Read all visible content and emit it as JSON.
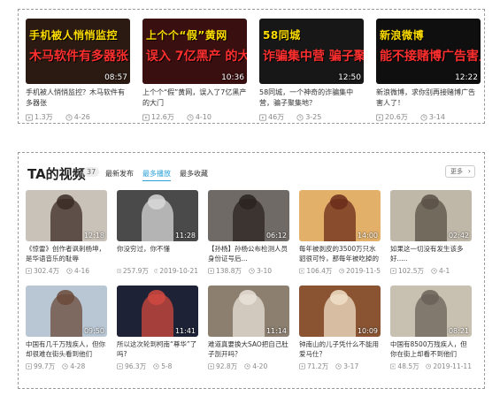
{
  "top_videos": [
    {
      "thumb_line1": "手机被人悄悄监控",
      "thumb_line2": "木马软件有多器张",
      "duration": "08:57",
      "title": "手机被人悄悄监控？木马软件有多器张",
      "plays": "1.3万",
      "date": "4-26",
      "bg": "#2b1a12"
    },
    {
      "thumb_line1": "上个个“假”黄网",
      "thumb_line2": "误入 7亿黑产 的大门",
      "duration": "10:36",
      "title": "上个个“假”黄网，误入了7亿黑产的大门",
      "plays": "12.6万",
      "date": "4-10",
      "bg": "#3a0f0f"
    },
    {
      "thumb_line1": "58同城",
      "thumb_line2": "诈骗集中营 骗子聚集地",
      "duration": "12:50",
      "title": "58同城，一个神奇的诈骗集中营，骗子聚集地？",
      "plays": "46万",
      "date": "3-25",
      "bg": "#171717"
    },
    {
      "thumb_line1": "新浪微博",
      "thumb_line2": "能不接赌博广告害人吗",
      "duration": "12:22",
      "title": "新浪微博，求你别再接赌博广告害人了！",
      "plays": "20.6万",
      "date": "3-14",
      "bg": "#0f0f0f"
    }
  ],
  "section": {
    "title": "TA的视频",
    "count": "37",
    "tabs": [
      "最新发布",
      "最多播放",
      "最多收藏"
    ],
    "active_tab": 1,
    "more_label": "更多"
  },
  "grid_videos": [
    {
      "duration": "12:18",
      "title": "《惊雷》创作者讽刺杨坤，是华语音乐的耻辱",
      "plays": "302.4万",
      "date": "4-16",
      "bg": "#c9c2b8",
      "fg": "#3a2a24"
    },
    {
      "duration": "11:28",
      "title": "你没穷过，你不懂",
      "plays": "257.9万",
      "date": "2019-10-21",
      "bg": "#4a4a4a",
      "fg": "#d8d8d8"
    },
    {
      "duration": "06:12",
      "title": "【孙杨】孙杨公布检测人员身份证号后...",
      "plays": "138.8万",
      "date": "3-10",
      "bg": "#6f6a66",
      "fg": "#2a2320"
    },
    {
      "duration": "14:00",
      "title": "每年被剥皮的3500万只水貂很可怜，那每年被吃掉的600",
      "plays": "106.4万",
      "date": "2019-11-5",
      "bg": "#e3b06a",
      "fg": "#6b2c1a"
    },
    {
      "duration": "02:42",
      "title": "如果这一切没有发生该多好.....",
      "plays": "102.5万",
      "date": "4-1",
      "bg": "#bfb7a8",
      "fg": "#5a5045"
    },
    {
      "duration": "09:50",
      "title": "中国有几千万残疾人，但你却很难在街头看到他们",
      "plays": "99.7万",
      "date": "4-28",
      "bg": "#b9c7d4",
      "fg": "#6a4a3a"
    },
    {
      "duration": "11:41",
      "title": "所以这次轮到柯南“尊华”了吗?",
      "plays": "96.3万",
      "date": "5-8",
      "bg": "#1d2236",
      "fg": "#d1493f"
    },
    {
      "duration": "11:14",
      "title": "难道真要换大SAO把自己肚子剖开吗？",
      "plays": "92.8万",
      "date": "4-20",
      "bg": "#8c7f70",
      "fg": "#e9e2d8"
    },
    {
      "duration": "10:09",
      "title": "钟南山的儿子凭什么不能用爱马仕？",
      "plays": "71.2万",
      "date": "3-17",
      "bg": "#8a5432",
      "fg": "#f0e0c8"
    },
    {
      "duration": "08:21",
      "title": "中国有8500万残疾人，但你在街上却看不到他们",
      "plays": "48.5万",
      "date": "2019-11-11",
      "bg": "#c8c0b0",
      "fg": "#6a6258"
    }
  ]
}
